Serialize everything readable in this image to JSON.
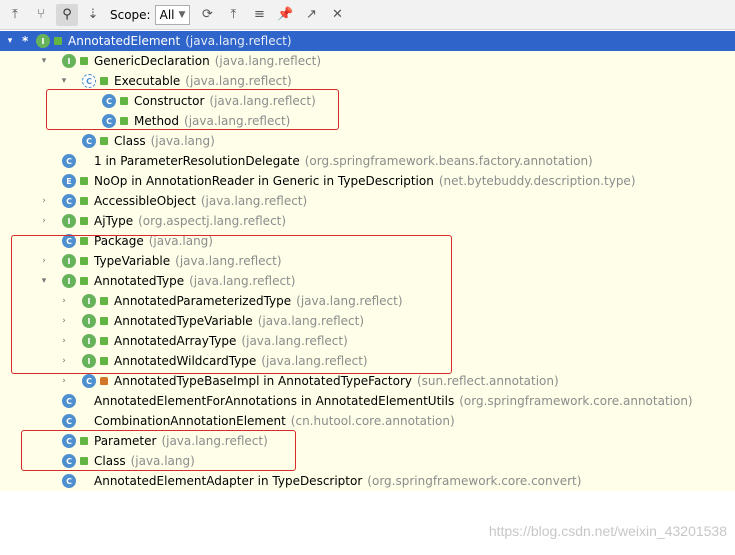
{
  "toolbar": {
    "buttons": [
      {
        "name": "supertypes-hierarchy-icon"
      },
      {
        "name": "subtypes-hierarchy-icon"
      },
      {
        "name": "type-hierarchy-icon"
      },
      {
        "name": "sort-alphabetically-icon"
      }
    ],
    "scope_label": "Scope:",
    "scope_value": "All",
    "right_buttons": [
      {
        "name": "refresh-icon"
      },
      {
        "name": "expand-all-icon"
      },
      {
        "name": "collapse-all-icon"
      },
      {
        "name": "pin-icon"
      },
      {
        "name": "export-icon"
      },
      {
        "name": "close-icon"
      }
    ]
  },
  "tree": {
    "rows": [
      {
        "arrow": "▾",
        "star": "*",
        "kind": "I",
        "vis": "pub",
        "name": "AnnotatedElement",
        "pkg": "(java.lang.reflect)",
        "selected": true
      },
      {
        "arrow": "▾",
        "kind": "I",
        "vis": "pub",
        "name": "GenericDeclaration",
        "pkg": "(java.lang.reflect)"
      },
      {
        "arrow": "▾",
        "kind": "Cabs",
        "vis": "pub",
        "name": "Executable",
        "pkg": "(java.lang.reflect)"
      },
      {
        "arrow": "",
        "kind": "C",
        "vis": "pub",
        "name": "Constructor",
        "pkg": "(java.lang.reflect)"
      },
      {
        "arrow": "",
        "kind": "C",
        "vis": "pub",
        "name": "Method",
        "pkg": "(java.lang.reflect)"
      },
      {
        "arrow": "",
        "kind": "C",
        "vis": "pub",
        "name": "Class",
        "pkg": "(java.lang)"
      },
      {
        "arrow": "",
        "kind": "C",
        "vis": "none",
        "name": "1 in ParameterResolutionDelegate",
        "pkg": "(org.springframework.beans.factory.annotation)"
      },
      {
        "arrow": "",
        "kind": "E",
        "vis": "pub",
        "name": "NoOp in AnnotationReader in Generic in TypeDescription",
        "pkg": "(net.bytebuddy.description.type)"
      },
      {
        "arrow": "›",
        "kind": "C",
        "vis": "pub",
        "name": "AccessibleObject",
        "pkg": "(java.lang.reflect)"
      },
      {
        "arrow": "›",
        "kind": "I",
        "vis": "pub",
        "name": "AjType",
        "pkg": "(org.aspectj.lang.reflect)"
      },
      {
        "arrow": "",
        "kind": "C",
        "vis": "pub",
        "name": "Package",
        "pkg": "(java.lang)"
      },
      {
        "arrow": "›",
        "kind": "I",
        "vis": "pub",
        "name": "TypeVariable",
        "pkg": "(java.lang.reflect)"
      },
      {
        "arrow": "▾",
        "kind": "I",
        "vis": "pub",
        "name": "AnnotatedType",
        "pkg": "(java.lang.reflect)"
      },
      {
        "arrow": "›",
        "kind": "I",
        "vis": "pub",
        "name": "AnnotatedParameterizedType",
        "pkg": "(java.lang.reflect)"
      },
      {
        "arrow": "›",
        "kind": "I",
        "vis": "pub",
        "name": "AnnotatedTypeVariable",
        "pkg": "(java.lang.reflect)"
      },
      {
        "arrow": "›",
        "kind": "I",
        "vis": "pub",
        "name": "AnnotatedArrayType",
        "pkg": "(java.lang.reflect)"
      },
      {
        "arrow": "›",
        "kind": "I",
        "vis": "pub",
        "name": "AnnotatedWildcardType",
        "pkg": "(java.lang.reflect)"
      },
      {
        "arrow": "›",
        "kind": "C",
        "vis": "pkg",
        "name": "AnnotatedTypeBaseImpl in AnnotatedTypeFactory",
        "pkg": "(sun.reflect.annotation)"
      },
      {
        "arrow": "",
        "kind": "C",
        "vis": "none",
        "name": "AnnotatedElementForAnnotations in AnnotatedElementUtils",
        "pkg": "(org.springframework.core.annotation)"
      },
      {
        "arrow": "",
        "kind": "C",
        "vis": "none",
        "name": "CombinationAnnotationElement",
        "pkg": "(cn.hutool.core.annotation)"
      },
      {
        "arrow": "",
        "kind": "C",
        "vis": "pub",
        "name": "Parameter",
        "pkg": "(java.lang.reflect)"
      },
      {
        "arrow": "",
        "kind": "C",
        "vis": "pub",
        "name": "Class",
        "pkg": "(java.lang)"
      },
      {
        "arrow": "",
        "kind": "C",
        "vis": "none",
        "name": "AnnotatedElementAdapter in TypeDescriptor",
        "pkg": "(org.springframework.core.convert)"
      }
    ]
  },
  "watermark": "https://blog.csdn.net/weixin_43201538"
}
